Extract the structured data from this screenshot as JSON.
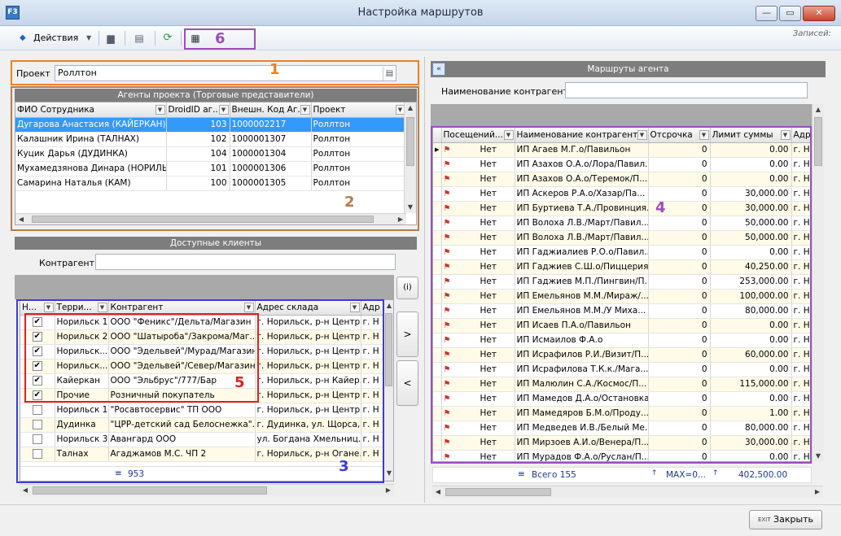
{
  "window": {
    "title": "Настройка маршрутов",
    "app_icon": "F3",
    "minimize": "—",
    "maximize": "▭",
    "close": "✕"
  },
  "toolbar": {
    "actions_label": "Действия",
    "records_label": "Записей:"
  },
  "annotations": [
    "1",
    "2",
    "3",
    "4",
    "5",
    "6"
  ],
  "project": {
    "label": "Проект",
    "value": "Роллтон"
  },
  "agents": {
    "title": "Агенты проекта (Торговые представители)",
    "columns": [
      "ФИО Сотрудника",
      "DroidID аг...",
      "Внешн. Код Аг...",
      "Проект"
    ],
    "rows": [
      {
        "name": "Дугарова Анастасия (КАЙЕРКАН)",
        "droid": "103",
        "ext": "1000002217",
        "project": "Роллтон"
      },
      {
        "name": "Калашник Ирина (ТАЛНАХ)",
        "droid": "102",
        "ext": "1000001307",
        "project": "Роллтон"
      },
      {
        "name": "Куцик Дарья (ДУДИНКА)",
        "droid": "104",
        "ext": "1000001304",
        "project": "Роллтон"
      },
      {
        "name": "Мухамедзянова Динара (НОРИЛЬС",
        "droid": "101",
        "ext": "1000001306",
        "project": "Роллтон"
      },
      {
        "name": "Самарина Наталья (КАМ)",
        "droid": "100",
        "ext": "1000001305",
        "project": "Роллтон"
      }
    ]
  },
  "clients": {
    "title": "Доступные клиенты",
    "filter_label": "Контрагент",
    "filter_value": "",
    "columns": [
      "Н...",
      "Терри...",
      "Контрагент",
      "Адрес склада",
      "Адр"
    ],
    "rows": [
      {
        "checked": true,
        "terr": "Норильск 1",
        "name": "ООО \"Феникс\"/Дельта/Магазин",
        "addr": "г. Норильск, р-н Центр...",
        "addr2": "г. Н"
      },
      {
        "checked": true,
        "terr": "Норильск 2",
        "name": "ООО \"Шатыроба\"/Закрома/Маг...",
        "addr": "г. Норильск, р-н Центр...",
        "addr2": "г. Н"
      },
      {
        "checked": true,
        "terr": "Норильск...",
        "name": "ООО \"Эдельвей\"/Мурад/Магазин",
        "addr": "г. Норильск, р-н Центр...",
        "addr2": "г. Н"
      },
      {
        "checked": true,
        "terr": "Норильск...",
        "name": "ООО \"Эдельвей\"/Север/Магазин",
        "addr": "г. Норильск, р-н Центр...",
        "addr2": "г. Н"
      },
      {
        "checked": true,
        "terr": "Кайеркан",
        "name": "ООО \"Эльбрус\"/777/Бар",
        "addr": "г. Норильск, р-н Кайер...",
        "addr2": "г. Н"
      },
      {
        "checked": true,
        "terr": "Прочие",
        "name": "Розничный покупатель",
        "addr": "г. Норильск, р-н Центр...",
        "addr2": "г. Н"
      },
      {
        "checked": false,
        "terr": "Норильск 1",
        "name": "\"Росавтосервис\" ТП ООО",
        "addr": "г. Норильск, р-н Центр...",
        "addr2": "г. Н"
      },
      {
        "checked": false,
        "terr": "Дудинка",
        "name": "\"ЦРР-детский сад Белоснежка\"...",
        "addr": "г. Дудинка, ул. Щорса,...",
        "addr2": "г. Н"
      },
      {
        "checked": false,
        "terr": "Норильск 3",
        "name": "Авангард ООО",
        "addr": "ул. Богдана Хмельниц...",
        "addr2": "г. Н"
      },
      {
        "checked": false,
        "terr": "Талнах",
        "name": "Агаджамов М.С. ЧП 2",
        "addr": "г. Норильск, р-н Огане...",
        "addr2": "г. Н"
      }
    ],
    "footer_count": "953"
  },
  "side_buttons": {
    "info": "(i)",
    "add": ">",
    "remove": "<"
  },
  "routes": {
    "title": "Маршруты агента",
    "filter_label": "Наименование контрагента",
    "filter_value": "",
    "columns": [
      "Посещений...",
      "Наименование контрагента",
      "Отсрочка",
      "Лимит суммы",
      "Адр"
    ],
    "rows": [
      {
        "visit": "Нет",
        "name": "ИП Агаев М.Г.о/Павильон",
        "delay": "0",
        "limit": "0.00",
        "addr": "г. Н"
      },
      {
        "visit": "Нет",
        "name": "ИП Азахов О.А.о/Лора/Павил...",
        "delay": "0",
        "limit": "0.00",
        "addr": "г. Н"
      },
      {
        "visit": "Нет",
        "name": "ИП Азахов О.А.о/Теремок/П...",
        "delay": "0",
        "limit": "0.00",
        "addr": "г. Н"
      },
      {
        "visit": "Нет",
        "name": "ИП Аскеров Р.А.о/Хазар/Па...",
        "delay": "0",
        "limit": "30,000.00",
        "addr": "г. Н"
      },
      {
        "visit": "Нет",
        "name": "ИП Буртиева Т.А./Провинция...",
        "delay": "0",
        "limit": "30,000.00",
        "addr": "г. Н"
      },
      {
        "visit": "Нет",
        "name": "ИП Волоха Л.В./Март/Павил...",
        "delay": "0",
        "limit": "50,000.00",
        "addr": "г. Н"
      },
      {
        "visit": "Нет",
        "name": "ИП Волоха Л.В./Март/Павил...",
        "delay": "0",
        "limit": "50,000.00",
        "addr": "г. Н"
      },
      {
        "visit": "Нет",
        "name": "ИП Гаджиалиев Р.О.о/Павил...",
        "delay": "0",
        "limit": "0.00",
        "addr": "г. Н"
      },
      {
        "visit": "Нет",
        "name": "ИП Гаджиев С.Ш.о/Пиццерия...",
        "delay": "0",
        "limit": "40,250.00",
        "addr": "г. Н"
      },
      {
        "visit": "Нет",
        "name": "ИП Гаджиев М.П./Пингвин/П...",
        "delay": "0",
        "limit": "253,000.00",
        "addr": "г. Н"
      },
      {
        "visit": "Нет",
        "name": "ИП Емельянов М.М./Мираж/...",
        "delay": "0",
        "limit": "100,000.00",
        "addr": "г. Н"
      },
      {
        "visit": "Нет",
        "name": "ИП Емельянов М.М./У Миха...",
        "delay": "0",
        "limit": "80,000.00",
        "addr": "г. Н"
      },
      {
        "visit": "Нет",
        "name": "ИП Исаев П.А.о/Павильон",
        "delay": "0",
        "limit": "0.00",
        "addr": "г. Н"
      },
      {
        "visit": "Нет",
        "name": "ИП Исмаилов Ф.А.о",
        "delay": "0",
        "limit": "0.00",
        "addr": "г. Н"
      },
      {
        "visit": "Нет",
        "name": "ИП Исрафилов Р.И./Визит/П...",
        "delay": "0",
        "limit": "60,000.00",
        "addr": "г. Н"
      },
      {
        "visit": "Нет",
        "name": "ИП Исрафилова Т.К.к./Мага...",
        "delay": "0",
        "limit": "0.00",
        "addr": "г. Н"
      },
      {
        "visit": "Нет",
        "name": "ИП Малюлин С.А./Космос/П...",
        "delay": "0",
        "limit": "115,000.00",
        "addr": "г. Н"
      },
      {
        "visit": "Нет",
        "name": "ИП Мамедов Д.А.о/Остановка",
        "delay": "0",
        "limit": "0.00",
        "addr": "г. Н"
      },
      {
        "visit": "Нет",
        "name": "ИП Мамедяров Б.М.о/Проду...",
        "delay": "0",
        "limit": "1.00",
        "addr": "г. Н"
      },
      {
        "visit": "Нет",
        "name": "ИП Медведев И.В./Белый Ме...",
        "delay": "0",
        "limit": "80,000.00",
        "addr": "г. Н"
      },
      {
        "visit": "Нет",
        "name": "ИП Мирзоев А.И.о/Венера/П...",
        "delay": "0",
        "limit": "30,000.00",
        "addr": "г. Н"
      },
      {
        "visit": "Нет",
        "name": "ИП Мурадов Ф.А.о/Руслан/П...",
        "delay": "0",
        "limit": "0.00",
        "addr": "г. Н"
      }
    ],
    "footer_total": "Всего 155",
    "footer_max": "MAX=0...",
    "footer_sum": "402,500.00"
  },
  "close_button": {
    "label": "Закрыть",
    "icon_text": "EXIT"
  },
  "colors": {
    "orange": "#f08020",
    "brown": "#b87a4b",
    "blue": "#3b3bd8",
    "purple": "#9b4fb8",
    "red": "#e02020",
    "selection": "#3399ff"
  }
}
